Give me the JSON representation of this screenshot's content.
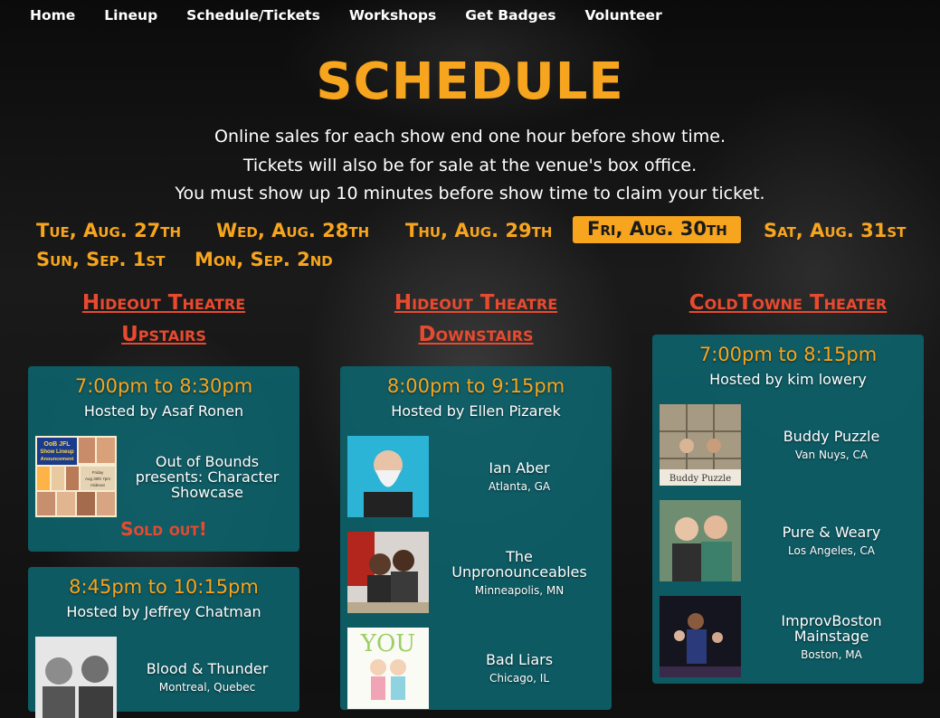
{
  "nav": {
    "items": [
      "Home",
      "Lineup",
      "Schedule/Tickets",
      "Workshops",
      "Get Badges",
      "Volunteer"
    ]
  },
  "page_title": "SCHEDULE",
  "intro": {
    "line1": "Online sales for each show end one hour before show time.",
    "line2": "Tickets will also be for sale at the venue's box office.",
    "line3": "You must show up 10 minutes before show time to claim your ticket."
  },
  "days": [
    {
      "label": "Tue, Aug. 27th",
      "active": false
    },
    {
      "label": "Wed, Aug. 28th",
      "active": false
    },
    {
      "label": "Thu, Aug. 29th",
      "active": false
    },
    {
      "label": "Fri, Aug. 30th",
      "active": true
    },
    {
      "label": "Sat, Aug. 31st",
      "active": false
    },
    {
      "label": "Sun, Sep. 1st",
      "active": false
    },
    {
      "label": "Mon, Sep. 2nd",
      "active": false
    }
  ],
  "venues": [
    {
      "line1": "Hideout Theatre",
      "line2": "Upstairs",
      "shows": [
        {
          "time": "7:00pm to 8:30pm",
          "host": "Hosted by Asaf Ronen",
          "acts": [
            {
              "name": "Out of Bounds presents: Character Showcase",
              "location": "",
              "poster": {
                "title": "OoB JFL Show Lineup Anouncement",
                "detail": "Friday Aug 30th 7pm Hideout Theatre"
              }
            }
          ],
          "status": "Sold out!"
        },
        {
          "time": "8:45pm to 10:15pm",
          "host": "Hosted by Jeffrey Chatman",
          "acts": [
            {
              "name": "Blood & Thunder",
              "location": "Montreal, Quebec"
            }
          ]
        }
      ]
    },
    {
      "line1": "Hideout Theatre",
      "line2": "Downstairs",
      "shows": [
        {
          "time": "8:00pm to 9:15pm",
          "host": "Hosted by Ellen Pizarek",
          "acts": [
            {
              "name": "Ian Aber",
              "location": "Atlanta, GA"
            },
            {
              "name": "The Unpronounceables",
              "location": "Minneapolis, MN"
            },
            {
              "name": "Bad Liars",
              "location": "Chicago, IL",
              "thumb_text": "YOU"
            }
          ]
        }
      ]
    },
    {
      "line1": "ColdTowne Theater",
      "shows": [
        {
          "time": "7:00pm to 8:15pm",
          "host": "Hosted by kim lowery",
          "acts": [
            {
              "name": "Buddy Puzzle",
              "location": "Van Nuys, CA",
              "thumb_text": "Buddy Puzzle"
            },
            {
              "name": "Pure & Weary",
              "location": "Los Angeles, CA"
            },
            {
              "name": "ImprovBoston Mainstage",
              "location": "Boston, MA"
            }
          ]
        }
      ]
    }
  ],
  "colors": {
    "accent_orange": "#f7a51e",
    "venue_red": "#e84a2f",
    "card_teal": "#0d646e"
  }
}
